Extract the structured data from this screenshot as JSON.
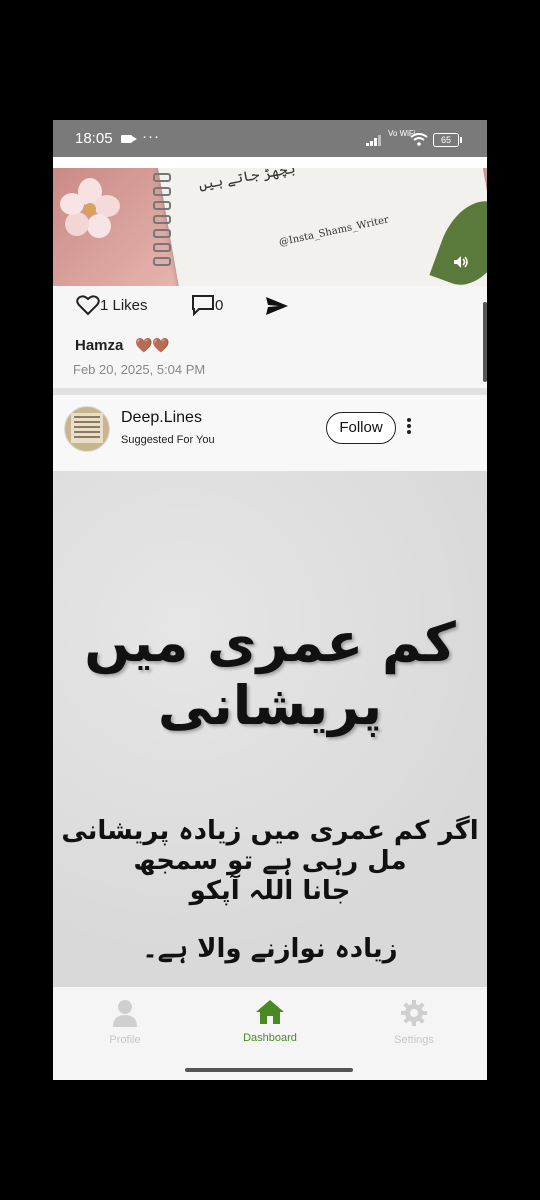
{
  "status_bar": {
    "time": "18:05",
    "dots": "···",
    "network": "Vo WiFi",
    "battery": "65"
  },
  "post1": {
    "watermark": "@Insta_Shams_Writer",
    "image_urdu": "بچھڑ جاتے ہیں",
    "likes_label": "1 Likes",
    "comments_count": "0",
    "caption_name": "Hamza",
    "caption_emoji": "🤎🤎",
    "date": "Feb 20, 2025, 5:04 PM"
  },
  "post2": {
    "username": "Deep.Lines",
    "subtitle": "Suggested For You",
    "follow_label": "Follow",
    "urdu_title": "کم عمری میں پریشانی",
    "urdu_line1": "اگر کم عمری میں زیادہ پریشانی مل رہی ہے تو سمجھ",
    "urdu_line2": "جانا اللہ آپکو",
    "urdu_line3": "زیادہ نوازنے والا ہے۔"
  },
  "bottom_nav": {
    "items": [
      {
        "label": "Profile",
        "icon": "person-icon"
      },
      {
        "label": "Dashboard",
        "icon": "home-icon"
      },
      {
        "label": "Settings",
        "icon": "gear-icon"
      }
    ],
    "active": "Dashboard",
    "active_color": "#4a8a24"
  }
}
